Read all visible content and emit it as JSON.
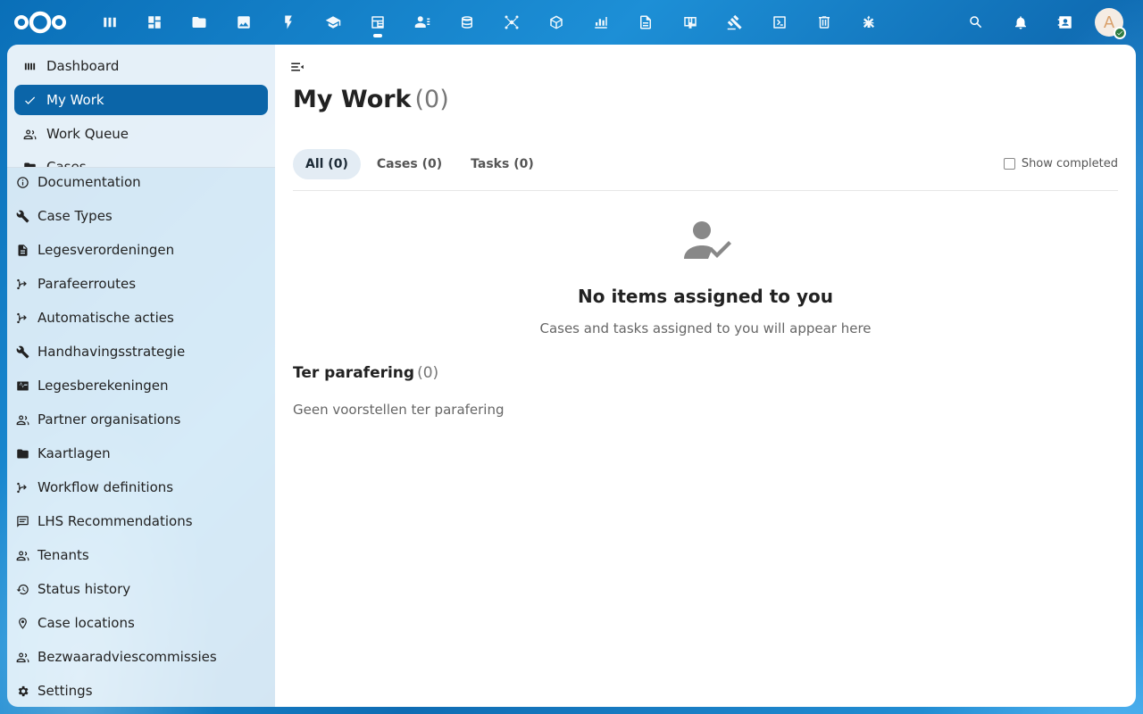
{
  "header": {
    "apps": [
      {
        "name": "dashboard-app-icon"
      },
      {
        "name": "grid-app-icon"
      },
      {
        "name": "files-app-icon"
      },
      {
        "name": "photos-app-icon"
      },
      {
        "name": "activity-app-icon"
      },
      {
        "name": "education-app-icon"
      },
      {
        "name": "procest-app-icon",
        "active": true
      },
      {
        "name": "contacts-app-icon"
      },
      {
        "name": "database-app-icon"
      },
      {
        "name": "network-app-icon"
      },
      {
        "name": "package-app-icon"
      },
      {
        "name": "chart-app-icon"
      },
      {
        "name": "document-app-icon"
      },
      {
        "name": "board-app-icon"
      },
      {
        "name": "gavel-app-icon"
      },
      {
        "name": "code-app-icon"
      },
      {
        "name": "trash-app-icon"
      },
      {
        "name": "tool-app-icon"
      }
    ],
    "avatar_initial": "A"
  },
  "sidebar": {
    "top_items": [
      {
        "label": "Dashboard",
        "icon": "dashboard-icon"
      },
      {
        "label": "My Work",
        "icon": "check-icon",
        "active": true
      },
      {
        "label": "Work Queue",
        "icon": "people-icon"
      },
      {
        "label": "Cases",
        "icon": "folder-icon"
      }
    ],
    "items": [
      {
        "label": "Documentation",
        "icon": "info-icon"
      },
      {
        "label": "Case Types",
        "icon": "wrench-icon"
      },
      {
        "label": "Legesverordeningen",
        "icon": "document-icon"
      },
      {
        "label": "Parafeerroutes",
        "icon": "flow-icon"
      },
      {
        "label": "Automatische acties",
        "icon": "flow-icon"
      },
      {
        "label": "Handhavingsstrategie",
        "icon": "wrench-icon"
      },
      {
        "label": "Legesberekeningen",
        "icon": "pulse-icon"
      },
      {
        "label": "Partner organisations",
        "icon": "people-icon"
      },
      {
        "label": "Kaartlagen",
        "icon": "folder-icon"
      },
      {
        "label": "Workflow definitions",
        "icon": "flow-icon"
      },
      {
        "label": "LHS Recommendations",
        "icon": "comment-icon"
      },
      {
        "label": "Tenants",
        "icon": "people-icon"
      },
      {
        "label": "Status history",
        "icon": "history-icon"
      },
      {
        "label": "Case locations",
        "icon": "pin-icon"
      },
      {
        "label": "Bezwaaradviescommissies",
        "icon": "people-icon"
      },
      {
        "label": "Settings",
        "icon": "gear-icon"
      }
    ]
  },
  "main": {
    "title": "My Work",
    "title_count": "(0)",
    "tabs": [
      {
        "label": "All (0)",
        "active": true
      },
      {
        "label": "Cases (0)"
      },
      {
        "label": "Tasks (0)"
      }
    ],
    "show_completed_label": "Show completed",
    "empty_title": "No items assigned to you",
    "empty_subtitle": "Cases and tasks assigned to you will appear here",
    "section_title": "Ter parafering",
    "section_count": "(0)",
    "section_empty": "Geen voorstellen ter parafering"
  }
}
